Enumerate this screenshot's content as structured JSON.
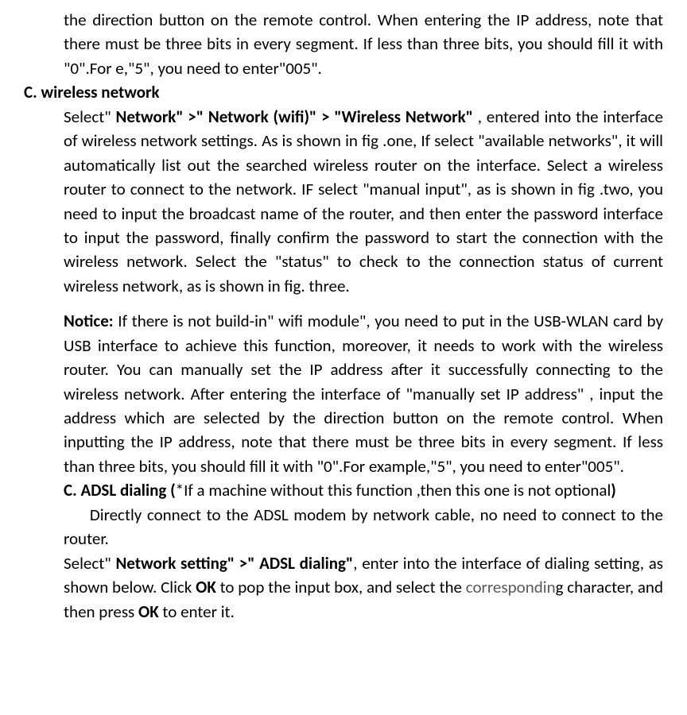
{
  "p1": "the direction button on the remote control. When entering the IP address, note that there must be three bits in every segment. If less than three bits, you should fill it with \"0\".For e,\"5\", you need to enter\"005\".",
  "p2_heading": "C. wireless network",
  "p3_prefix": "Select\" ",
  "p3_bold": "Network\" >\" Network (wifi)\" > \"Wireless Network\"",
  "p3_suffix": " , entered into the interface of wireless network settings. As is shown in fig .one, If select \"available networks\", it will automatically list out the searched wireless router on the interface. Select a wireless router to connect to the network. IF select \"manual input\", as is shown in fig .two, you need to input the broadcast name of the router, and then enter the password interface to input the password, finally confirm the password to start the connection with the wireless network. Select the \"status\" to check to the connection status of current wireless network, as is shown in fig. three.",
  "p4_bold": "Notice:",
  "p4_text": " If there is not build-in\" wifi module\", you need to put in the USB-WLAN card by USB interface to achieve this function, moreover, it   needs to work with the wireless router. You can manually set the IP address after it successfully connecting to the wireless network. After entering the interface of \"manually set IP address\" , input the address which are selected by the direction button on the remote control. When inputting the IP address, note that there must be three bits in every segment. If less than three bits, you should fill it with \"0\".For example,\"5\", you need to enter\"005\".",
  "p5_bold1": "C. ADSL dialing (",
  "p5_text": "*If a machine without this function ,then this one is not optional",
  "p5_bold2": ")",
  "p6": "     Directly connect to the ADSL modem by network cable, no need to connect to the router.",
  "p7_prefix": "Select\" ",
  "p7_bold1": "Network setting\" >\" ADSL dialing\"",
  "p7_mid1": ", enter into the interface of dialing setting, as shown below. Click ",
  "p7_bold2": "OK",
  "p7_mid2": " to pop the input box, and select the ",
  "p7_corresponding": "correspondin",
  "p7_g": "g",
  "p7_mid3": " character, and then press ",
  "p7_bold3": "OK",
  "p7_end": " to enter it."
}
